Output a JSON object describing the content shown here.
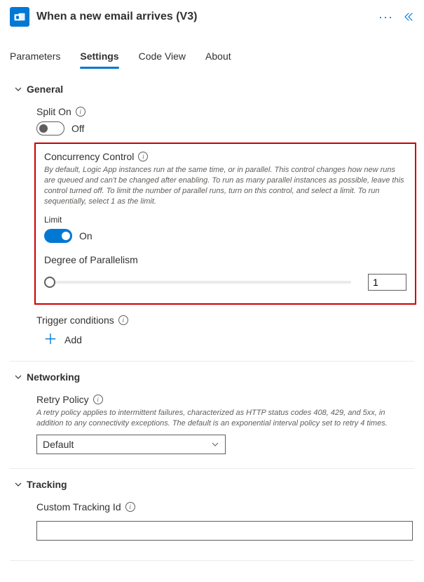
{
  "header": {
    "title": "When a new email arrives (V3)"
  },
  "tabs": [
    "Parameters",
    "Settings",
    "Code View",
    "About"
  ],
  "activeTabIndex": 1,
  "general": {
    "heading": "General",
    "splitOn": {
      "label": "Split On",
      "state": "Off"
    },
    "concurrency": {
      "label": "Concurrency Control",
      "description": "By default, Logic App instances run at the same time, or in parallel. This control changes how new runs are queued and can't be changed after enabling. To run as many parallel instances as possible, leave this control turned off. To limit the number of parallel runs, turn on this control, and select a limit. To run sequentially, select 1 as the limit.",
      "limitLabel": "Limit",
      "state": "On",
      "degreeLabel": "Degree of Parallelism",
      "degreeValue": "1"
    },
    "triggerConditions": {
      "label": "Trigger conditions",
      "addLabel": "Add"
    }
  },
  "networking": {
    "heading": "Networking",
    "retry": {
      "label": "Retry Policy",
      "description": "A retry policy applies to intermittent failures, characterized as HTTP status codes 408, 429, and 5xx, in addition to any connectivity exceptions. The default is an exponential interval policy set to retry 4 times.",
      "value": "Default"
    }
  },
  "tracking": {
    "heading": "Tracking",
    "customId": {
      "label": "Custom Tracking Id",
      "value": ""
    }
  }
}
